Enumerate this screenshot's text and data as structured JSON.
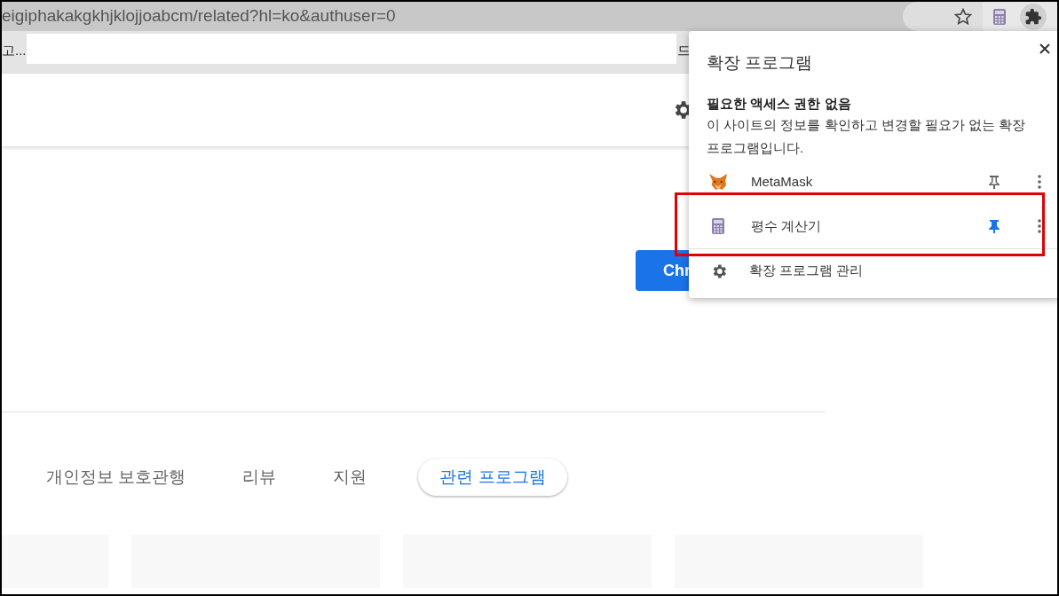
{
  "address_bar": {
    "url": "eigiphakakgkhjklojjoabcm/related?hl=ko&authuser=0"
  },
  "bookmarks_bar": {
    "left_text": "고...",
    "right_text": "드"
  },
  "page": {
    "button_label": "Chr",
    "tabs": [
      {
        "label": "개인정보 보호관행",
        "selected": false
      },
      {
        "label": "리뷰",
        "selected": false
      },
      {
        "label": "지원",
        "selected": false
      },
      {
        "label": "관련 프로그램",
        "selected": true
      }
    ],
    "cards": [
      {
        "kind": "placeholder"
      },
      {
        "kind": "placeholder"
      },
      {
        "kind": "placeholder"
      },
      {
        "kind": "placeholder"
      }
    ]
  },
  "extensions_popup": {
    "title": "확장 프로그램",
    "section_heading": "필요한 액세스 권한 없음",
    "section_text": "이 사이트의 정보를 확인하고 변경할 필요가 없는 확장 프로그램입니다.",
    "items": [
      {
        "kind": "fox",
        "name": "MetaMask",
        "pinned": false,
        "highlighted": false
      },
      {
        "kind": "calculator",
        "name": "평수 계산기",
        "pinned": true,
        "highlighted": true
      }
    ],
    "manage_label": "확장 프로그램 관리"
  }
}
